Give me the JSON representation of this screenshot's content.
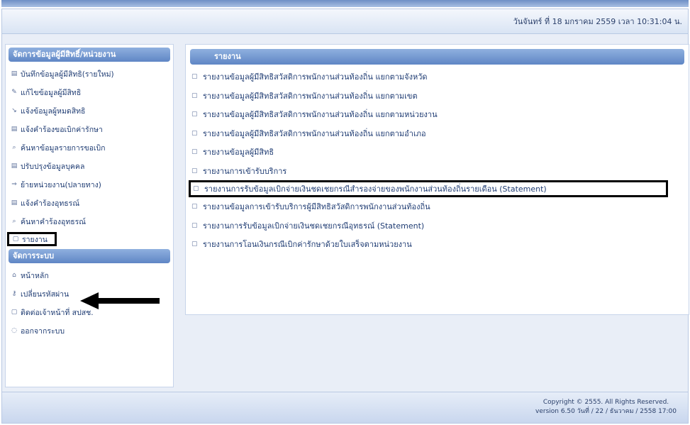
{
  "header": {
    "datetime": "วันจันทร์ ที่ 18 มกราคม 2559 เวลา 10:31:04 น."
  },
  "sidebar": {
    "section1_title": "จัดการข้อมูลผู้มีสิทธิ์/หน่วยงาน",
    "items": [
      {
        "label": "บันทึกข้อมูลผู้มีสิทธิ(รายใหม่)",
        "icon": "record-icon"
      },
      {
        "label": "แก้ไขข้อมูลผู้มีสิทธิ",
        "icon": "edit-icon"
      },
      {
        "label": "แจ้งข้อมูลผู้หมดสิทธิ",
        "icon": "notify-icon"
      },
      {
        "label": "แจ้งคำร้องขอเบิกค่ารักษา",
        "icon": "request-icon"
      },
      {
        "label": "ค้นหาข้อมูลรายการขอเบิก",
        "icon": "search-icon"
      },
      {
        "label": "ปรับปรุงข้อมูลบุคคล",
        "icon": "update-icon"
      },
      {
        "label": "ย้ายหน่วยงาน(ปลายทาง)",
        "icon": "move-icon"
      },
      {
        "label": "แจ้งคำร้องอุทธรณ์",
        "icon": "appeal-icon"
      },
      {
        "label": "ค้นหาคำร้องอุทธรณ์",
        "icon": "search-icon"
      },
      {
        "label": "รายงาน",
        "icon": "report-icon"
      }
    ],
    "section2_title": "จัดการระบบ",
    "system_items": [
      {
        "label": "หน้าหลัก",
        "icon": "home-icon"
      },
      {
        "label": "เปลี่ยนรหัสผ่าน",
        "icon": "key-icon"
      },
      {
        "label": "ติดต่อเจ้าหน้าที่ สปสช.",
        "icon": "contact-icon"
      },
      {
        "label": "ออกจากระบบ",
        "icon": "logout-icon"
      }
    ]
  },
  "main": {
    "title": "รายงาน",
    "reports": [
      "รายงานข้อมูลผู้มีสิทธิสวัสดิการพนักงานส่วนท้องถิ่น แยกตามจังหวัด",
      "รายงานข้อมูลผู้มีสิทธิสวัสดิการพนักงานส่วนท้องถิ่น แยกตามเขต",
      "รายงานข้อมูลผู้มีสิทธิสวัสดิการพนักงานส่วนท้องถิ่น แยกตามหน่วยงาน",
      "รายงานข้อมูลผู้มีสิทธิสวัสดิการพนักงานส่วนท้องถิ่น แยกตามอำเภอ",
      "รายงานข้อมูลผู้มีสิทธิ",
      "รายงานการเข้ารับบริการ",
      "รายงานการรับข้อมูลเบิกจ่ายเงินชดเชยกรณีสำรองจ่ายของพนักงานส่วนท้องถิ่นรายเดือน (Statement)",
      "รายงานข้อมูลการเข้ารับบริการผู้มีสิทธิสวัสดิการพนักงานส่วนท้องถิ่น",
      "รายงานการรับข้อมูลเบิกจ่ายเงินชดเชยกรณีอุทธรณ์ (Statement)",
      "รายงานการโอนเงินกรณีเบิกค่ารักษาด้วยใบเสร็จตามหน่วยงาน"
    ]
  },
  "footer": {
    "copyright": "Copyright © 2555. All Rights Reserved.",
    "version": "version 6.50 วันที่ / 22 / ธันวาคม / 2558 17:00"
  }
}
